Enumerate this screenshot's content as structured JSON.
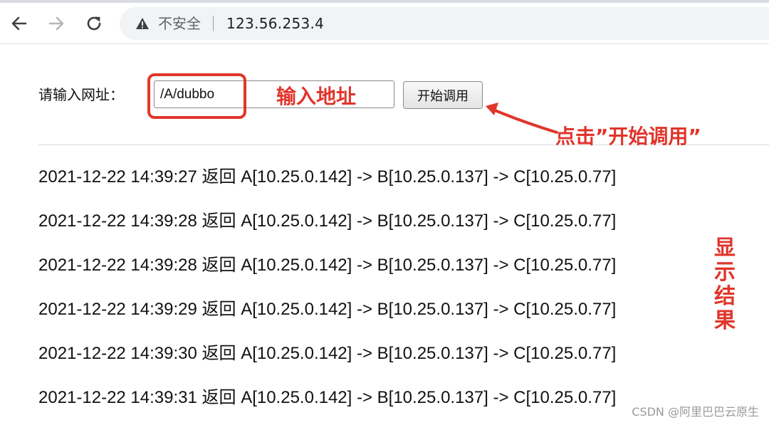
{
  "browser": {
    "back_icon": "back-arrow-icon",
    "forward_icon": "forward-arrow-icon",
    "reload_icon": "reload-icon",
    "security_icon": "warning-triangle-icon",
    "security_label": "不安全",
    "url": "123.56.253.4"
  },
  "form": {
    "label": "请输入网址：",
    "input_value": "/A/dubbo",
    "button_label": "开始调用"
  },
  "results": [
    "2021-12-22 14:39:27 返回 A[10.25.0.142] -> B[10.25.0.137] -> C[10.25.0.77]",
    "2021-12-22 14:39:28 返回 A[10.25.0.142] -> B[10.25.0.137] -> C[10.25.0.77]",
    "2021-12-22 14:39:28 返回 A[10.25.0.142] -> B[10.25.0.137] -> C[10.25.0.77]",
    "2021-12-22 14:39:29 返回 A[10.25.0.142] -> B[10.25.0.137] -> C[10.25.0.77]",
    "2021-12-22 14:39:30 返回 A[10.25.0.142] -> B[10.25.0.137] -> C[10.25.0.77]",
    "2021-12-22 14:39:31 返回 A[10.25.0.142] -> B[10.25.0.137] -> C[10.25.0.77]"
  ],
  "annotations": {
    "input_note": "输入地址",
    "click_note": "点击”开始调用”",
    "result_note": "显示结果",
    "color": "#e0352b"
  },
  "watermark": "CSDN @阿里巴巴云原生"
}
